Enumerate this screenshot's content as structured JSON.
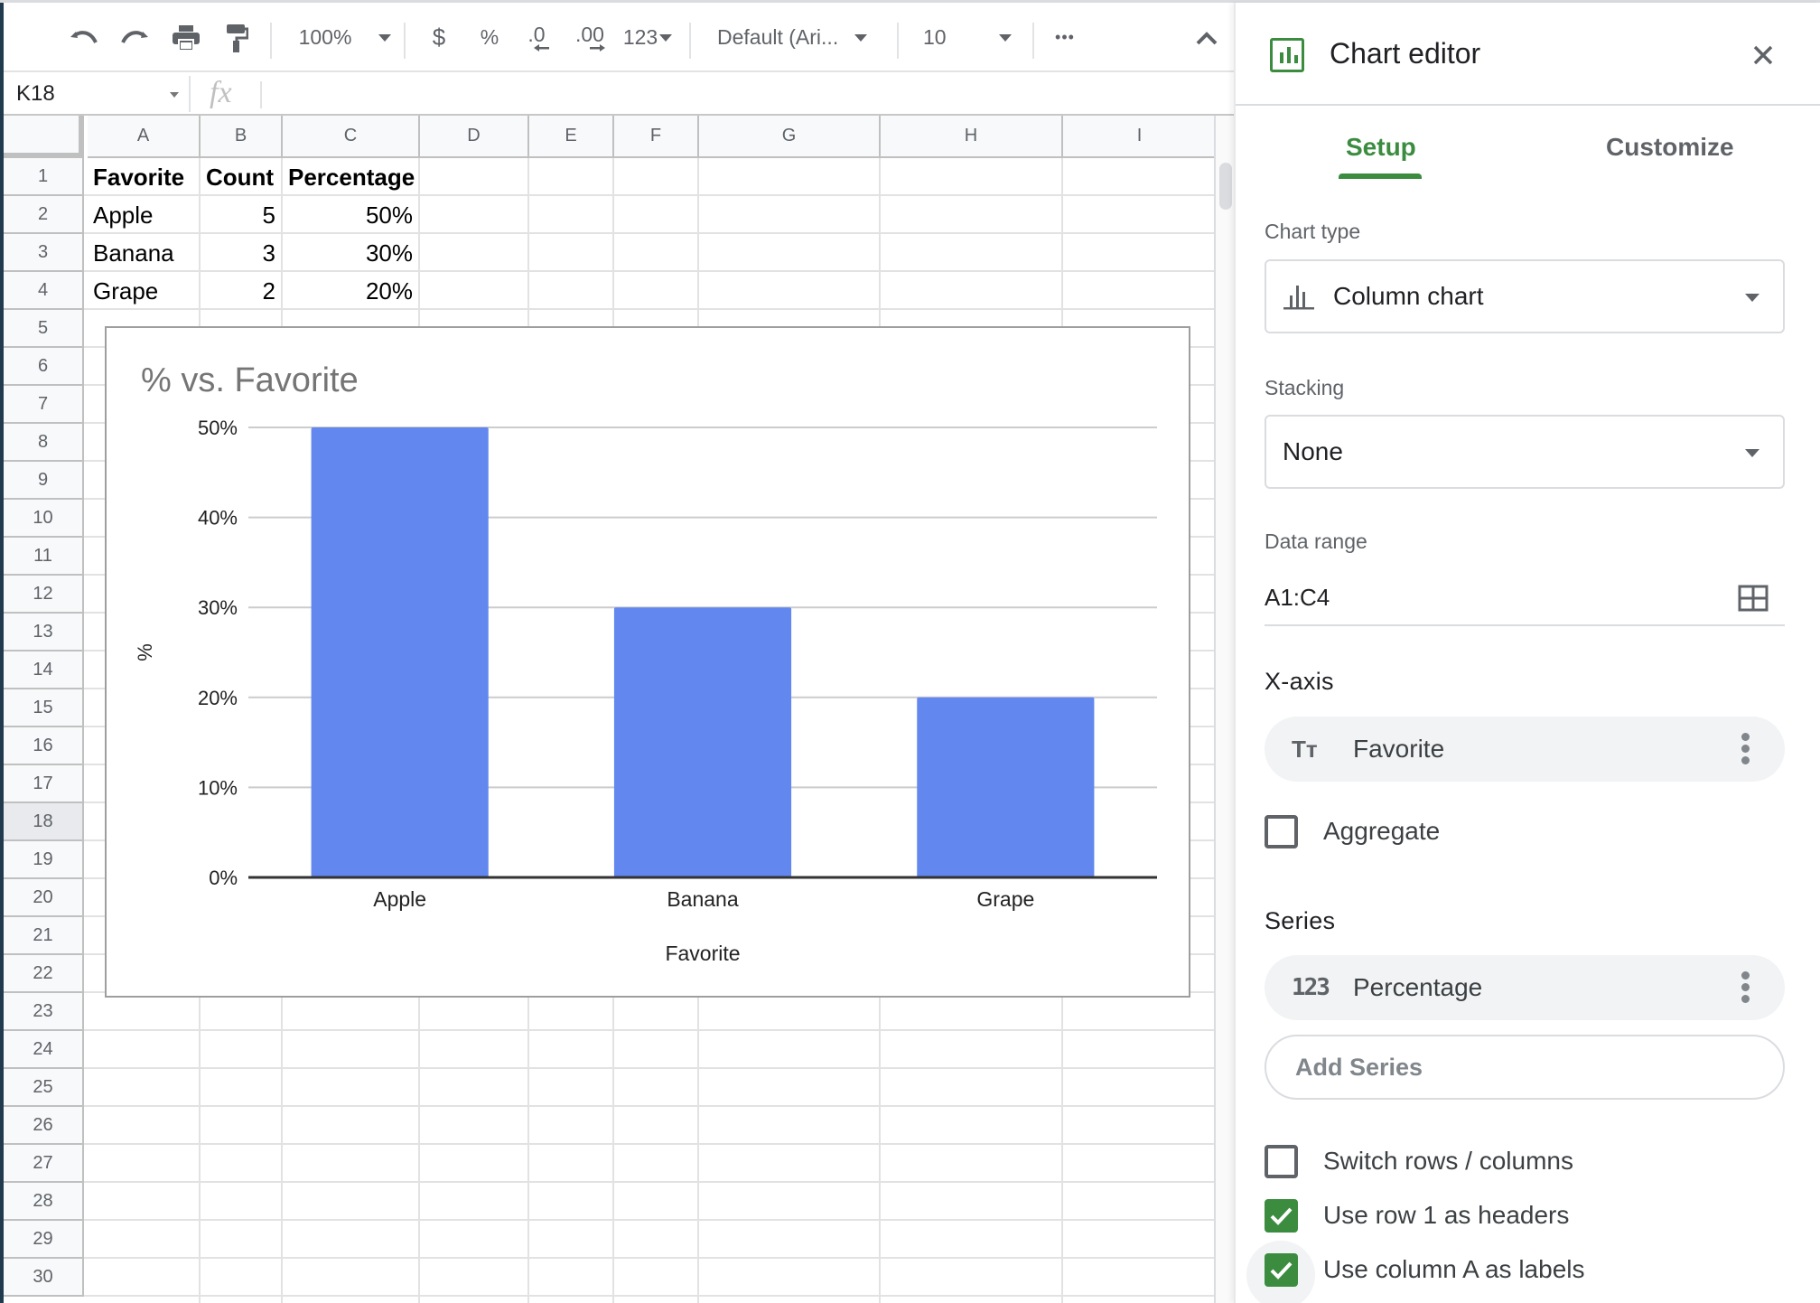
{
  "toolbar": {
    "zoom": "100%",
    "currency": "$",
    "percent": "%",
    "decrease_decimal": ".0",
    "increase_decimal": ".00",
    "more_formats": "123",
    "font": "Default (Ari...",
    "font_size": "10",
    "more": "•••"
  },
  "formula_bar": {
    "name_box": "K18",
    "fx_label": "fx",
    "formula": ""
  },
  "grid": {
    "columns": [
      "A",
      "B",
      "C",
      "D",
      "E",
      "F",
      "G",
      "H",
      "I"
    ],
    "rows": [
      "1",
      "2",
      "3",
      "4",
      "5",
      "6",
      "7",
      "8",
      "9",
      "10",
      "11",
      "12",
      "13",
      "14",
      "15",
      "16",
      "17",
      "18",
      "19",
      "20",
      "21",
      "22",
      "23",
      "24",
      "25",
      "26",
      "27",
      "28",
      "29",
      "30"
    ],
    "selected_row": "18",
    "cells": {
      "A1": "Favorite",
      "B1": "Count",
      "C1": "Percentage",
      "A2": "Apple",
      "B2": "5",
      "C2": "50%",
      "A3": "Banana",
      "B3": "3",
      "C3": "30%",
      "A4": "Grape",
      "B4": "2",
      "C4": "20%"
    }
  },
  "chart_data": {
    "type": "bar",
    "title": "% vs. Favorite",
    "xlabel": "Favorite",
    "ylabel": "%",
    "categories": [
      "Apple",
      "Banana",
      "Grape"
    ],
    "values": [
      50,
      30,
      20
    ],
    "ylim": [
      0,
      50
    ],
    "yticks": [
      "0%",
      "10%",
      "20%",
      "30%",
      "40%",
      "50%"
    ],
    "ytick_values": [
      0,
      10,
      20,
      30,
      40,
      50
    ],
    "grid": true,
    "legend": "none",
    "color": "#6287ef"
  },
  "editor": {
    "title": "Chart editor",
    "tabs": [
      {
        "label": "Setup",
        "active": true
      },
      {
        "label": "Customize",
        "active": false
      }
    ],
    "chart_type_label": "Chart type",
    "chart_type_value": "Column chart",
    "stacking_label": "Stacking",
    "stacking_value": "None",
    "data_range_label": "Data range",
    "data_range_value": "A1:C4",
    "x_axis_label": "X-axis",
    "x_axis_chip": "Favorite",
    "x_axis_chip_icon": "Tт",
    "aggregate_label": "Aggregate",
    "aggregate_checked": false,
    "series_label": "Series",
    "series_chip": "Percentage",
    "series_chip_icon": "123",
    "add_series": "Add Series",
    "options": [
      {
        "label": "Switch rows / columns",
        "checked": false
      },
      {
        "label": "Use row 1 as headers",
        "checked": true
      },
      {
        "label": "Use column A as labels",
        "checked": true
      }
    ],
    "accent_color": "#3c8c40"
  }
}
